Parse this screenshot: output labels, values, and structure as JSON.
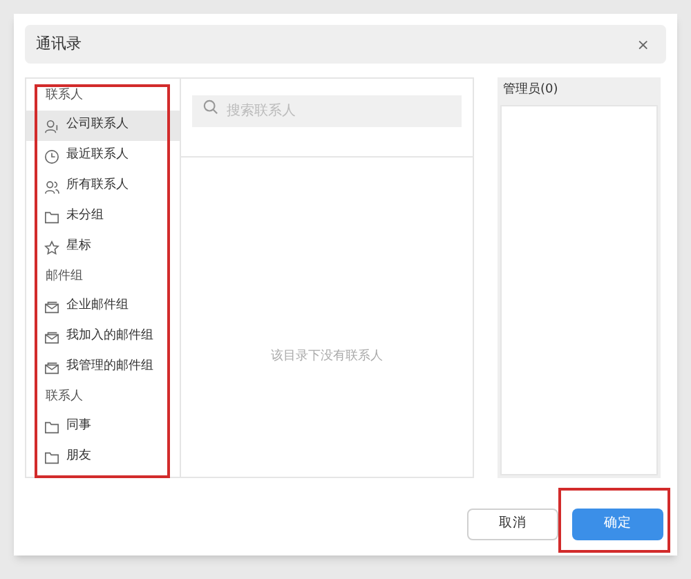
{
  "dialog": {
    "title": "通讯录",
    "close": "×"
  },
  "sidebar": [
    {
      "kind": "section",
      "label": "联系人"
    },
    {
      "kind": "item",
      "label": "公司联系人",
      "selected": true
    },
    {
      "kind": "item",
      "label": "最近联系人",
      "selected": false
    },
    {
      "kind": "item",
      "label": "所有联系人",
      "selected": false
    },
    {
      "kind": "item",
      "label": "未分组",
      "selected": false
    },
    {
      "kind": "item",
      "label": "星标",
      "selected": false
    },
    {
      "kind": "section",
      "label": "邮件组"
    },
    {
      "kind": "item",
      "label": "企业邮件组",
      "selected": false
    },
    {
      "kind": "item",
      "label": "我加入的邮件组",
      "selected": false
    },
    {
      "kind": "item",
      "label": "我管理的邮件组",
      "selected": false
    },
    {
      "kind": "section",
      "label": "联系人"
    },
    {
      "kind": "item",
      "label": "同事",
      "selected": false
    },
    {
      "kind": "item",
      "label": "朋友",
      "selected": false
    }
  ],
  "search": {
    "placeholder": "搜索联系人"
  },
  "empty_message": "该目录下没有联系人",
  "admins": {
    "title": "管理员(0)"
  },
  "buttons": [
    {
      "kind": "secondary",
      "label": "取消"
    },
    {
      "kind": "primary",
      "label": "确定"
    }
  ]
}
